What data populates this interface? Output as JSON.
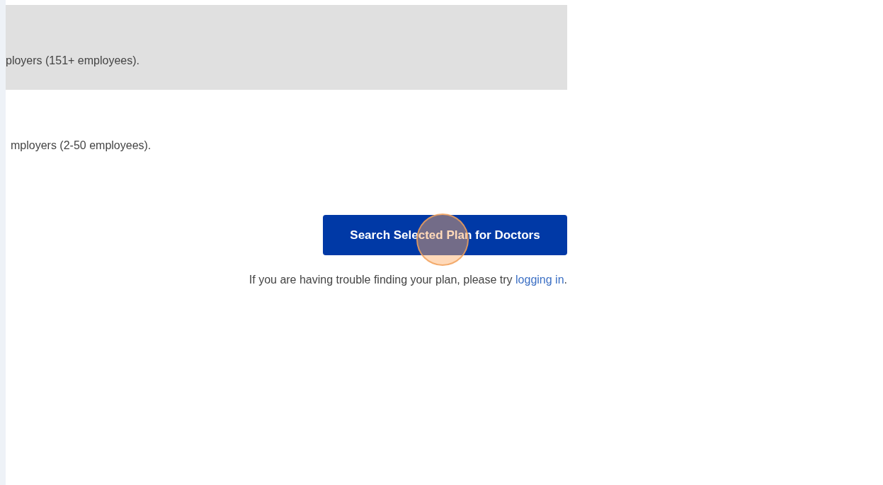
{
  "plan_options": [
    {
      "label": "ployers (151+ employees).",
      "selected": true
    },
    {
      "label": "mployers (2-50 employees).",
      "selected": false
    }
  ],
  "search_button": "Search Selected Plan for Doctors",
  "help_text": {
    "before": "If you are having trouble finding your plan, please try ",
    "link": "logging in",
    "after": "."
  }
}
